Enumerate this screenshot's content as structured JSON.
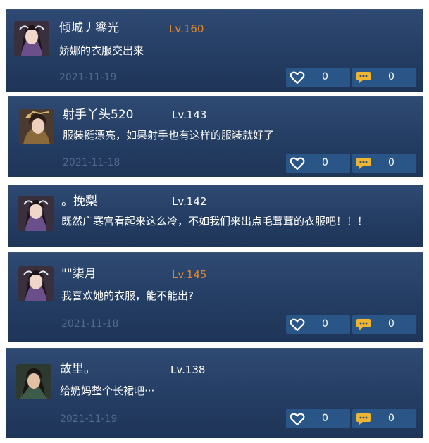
{
  "comments": [
    {
      "name": "倾城丿鎏光",
      "level": "Lv.160",
      "level_color": "orange",
      "text": "娇娜的衣服交出来",
      "date": "2021-11-19",
      "likes": "0",
      "replies": "0",
      "avatar": "female-hero-avatar"
    },
    {
      "name": "射手丫头520",
      "level": "Lv.143",
      "level_color": "white",
      "text": "服装挺漂亮，如果射手也有这样的服装就好了",
      "date": "2021-11-18",
      "likes": "0",
      "replies": "0",
      "avatar": "female-archer-avatar"
    },
    {
      "name": "。挽梨",
      "level": "Lv.142",
      "level_color": "white",
      "text": "既然广寒宫看起来这么冷，不如我们来出点毛茸茸的衣服吧！！！",
      "date": "",
      "likes": "",
      "replies": "",
      "avatar": "female-hero-avatar"
    },
    {
      "name": "\"\"柒月",
      "level": "Lv.145",
      "level_color": "orange",
      "text": "我喜欢她的衣服，能不能出?",
      "date": "2021-11-18",
      "likes": "0",
      "replies": "0",
      "avatar": "female-hero-avatar"
    },
    {
      "name": "故里。",
      "level": "Lv.138",
      "level_color": "white",
      "text": "给奶妈整个长裙吧···",
      "date": "2021-11-19",
      "likes": "0",
      "replies": "0",
      "avatar": "male-hero-avatar"
    }
  ],
  "colors": {
    "card_bg": "#243d63",
    "badge_bg": "#2a5587",
    "level_orange": "#e2882a",
    "reply_icon": "#f0b530"
  },
  "icons": {
    "like": "heart-icon",
    "reply": "speech-bubble-icon"
  }
}
